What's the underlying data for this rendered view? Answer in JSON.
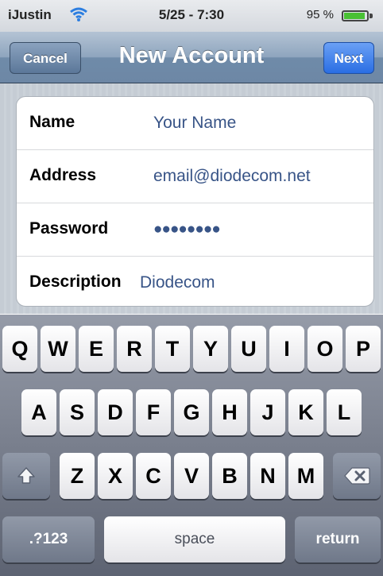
{
  "status_bar": {
    "carrier": "iJustin",
    "wifi_icon": "wifi-icon",
    "time": "5/25 - 7:30",
    "battery_pct": "95 %",
    "battery_level": 0.95,
    "battery_color": "#49c134"
  },
  "nav": {
    "title": "New Account",
    "cancel_label": "Cancel",
    "next_label": "Next"
  },
  "form": {
    "rows": [
      {
        "label": "Name",
        "value": "Your Name"
      },
      {
        "label": "Address",
        "value": "email@diodecom.net"
      },
      {
        "label": "Password",
        "value": "●●●●●●●●"
      },
      {
        "label": "Description",
        "value": "Diodecom"
      }
    ]
  },
  "keyboard": {
    "row1": [
      "Q",
      "W",
      "E",
      "R",
      "T",
      "Y",
      "U",
      "I",
      "O",
      "P"
    ],
    "row2": [
      "A",
      "S",
      "D",
      "F",
      "G",
      "H",
      "J",
      "K",
      "L"
    ],
    "row3": [
      "Z",
      "X",
      "C",
      "V",
      "B",
      "N",
      "M"
    ],
    "shift_icon": "shift-icon",
    "delete_icon": "delete-icon",
    "numbers_label": ".?123",
    "space_label": "space",
    "return_label": "return"
  }
}
